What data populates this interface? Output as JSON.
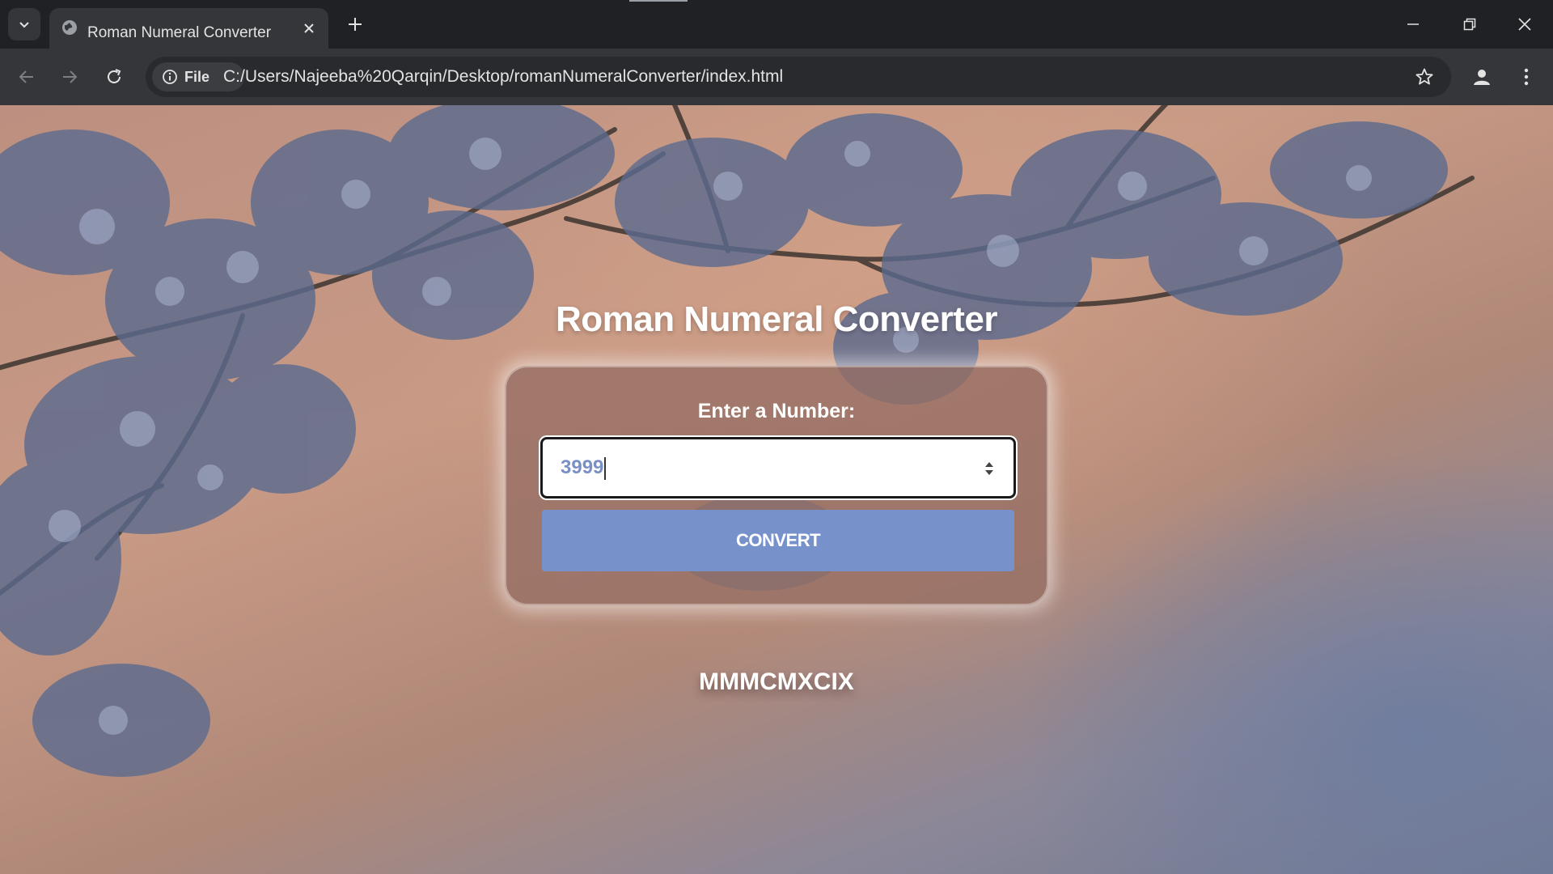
{
  "browser": {
    "tab_title": "Roman Numeral Converter",
    "url": "C:/Users/Najeeba%20Qarqin/Desktop/romanNumeralConverter/index.html",
    "file_chip_label": "File",
    "icons": [
      "tab-list-icon",
      "globe-icon",
      "close-icon",
      "plus-icon",
      "minimize-icon",
      "restore-icon",
      "window-close-icon",
      "back-arrow-icon",
      "forward-arrow-icon",
      "reload-icon",
      "info-icon",
      "star-icon",
      "profile-icon",
      "kebab-menu-icon"
    ]
  },
  "page": {
    "title": "Roman Numeral Converter",
    "input_label": "Enter a Number:",
    "input_value": "3999",
    "convert_label": "CONVERT",
    "result": "MMMCMXCIX"
  },
  "colors": {
    "button": "#7792cb",
    "input_text": "#7a90c4",
    "chrome_dark": "#202124",
    "chrome_toolbar": "#35363a"
  }
}
